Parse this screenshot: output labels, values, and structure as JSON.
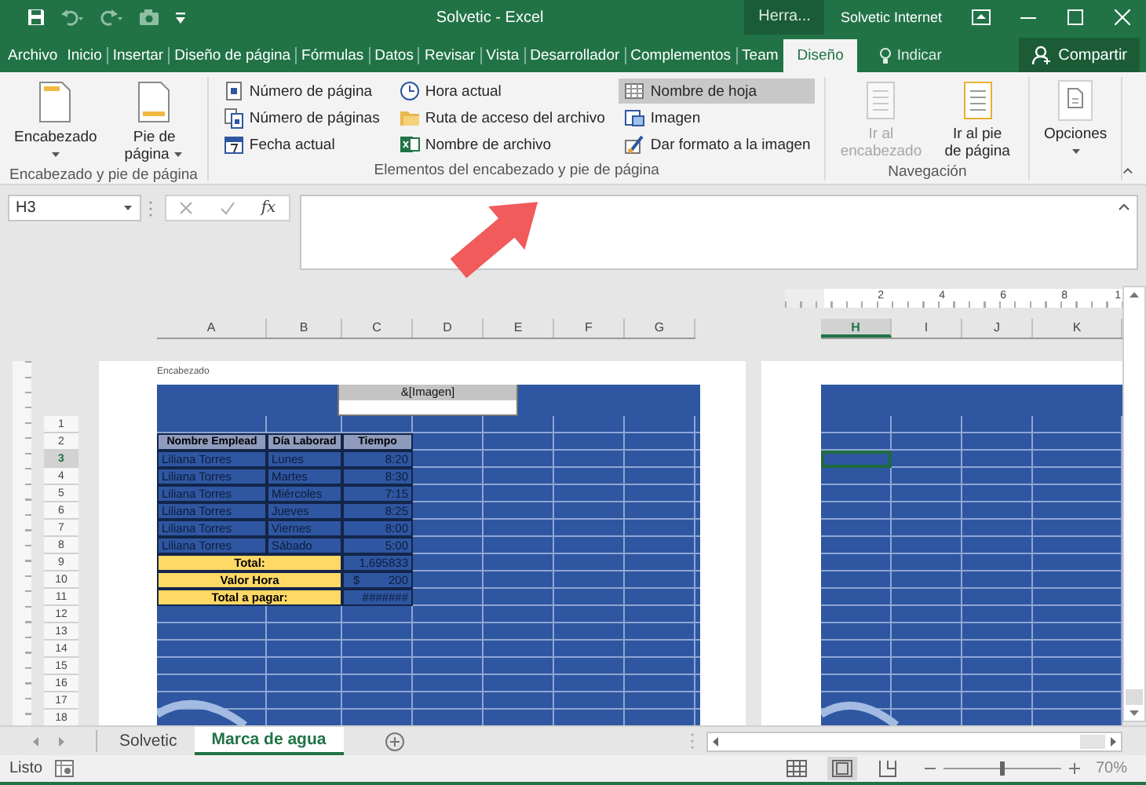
{
  "window": {
    "title": "Solvetic - Excel",
    "context_label": "Herra...",
    "account": "Solvetic Internet"
  },
  "ribbon_tabs": [
    {
      "label": "Archivo",
      "selected": false
    },
    {
      "label": "Inicio",
      "selected": false
    },
    {
      "label": "Insertar",
      "selected": false
    },
    {
      "label": "Diseño de página",
      "selected": false
    },
    {
      "label": "Fórmulas",
      "selected": false
    },
    {
      "label": "Datos",
      "selected": false
    },
    {
      "label": "Revisar",
      "selected": false
    },
    {
      "label": "Vista",
      "selected": false
    },
    {
      "label": "Desarrollador",
      "selected": false
    },
    {
      "label": "Complementos",
      "selected": false
    },
    {
      "label": "Team",
      "selected": false
    },
    {
      "label": "Diseño",
      "selected": true
    }
  ],
  "tell_me": "Indicar",
  "share_button": "Compartir",
  "ribbon_groups": [
    {
      "kind": "large",
      "label": "Encabezado y pie de página",
      "buttons": [
        {
          "label": "Encabezado",
          "dropdown": true,
          "disabled": false
        },
        {
          "label": "Pie de página",
          "dropdown": true,
          "disabled": false
        }
      ]
    },
    {
      "kind": "small",
      "label": "Elementos del encabezado y pie de página",
      "columns": [
        [
          {
            "label": "Número de página",
            "highlighted": false
          },
          {
            "label": "Número de páginas",
            "highlighted": false
          },
          {
            "label": "Fecha actual",
            "highlighted": false
          }
        ],
        [
          {
            "label": "Hora actual",
            "highlighted": false
          },
          {
            "label": "Ruta de acceso del archivo",
            "highlighted": false
          },
          {
            "label": "Nombre de archivo",
            "highlighted": false
          }
        ],
        [
          {
            "label": "Nombre de hoja",
            "highlighted": true
          },
          {
            "label": "Imagen",
            "highlighted": false
          },
          {
            "label": "Dar formato a la imagen",
            "highlighted": false
          }
        ]
      ]
    },
    {
      "kind": "large",
      "label": "Navegación",
      "buttons": [
        {
          "label": "Ir al encabezado",
          "dropdown": false,
          "disabled": true
        },
        {
          "label": "Ir al pie de página",
          "dropdown": false,
          "disabled": false
        }
      ]
    },
    {
      "kind": "options",
      "buttons": [
        {
          "label": "Opciones",
          "dropdown": true,
          "disabled": false
        }
      ]
    }
  ],
  "formula_bar": {
    "name_box": "H3",
    "function_label": "fx"
  },
  "sheet": {
    "columns_left": [
      {
        "label": "A",
        "selected": false
      },
      {
        "label": "B",
        "selected": false
      },
      {
        "label": "C",
        "selected": false
      },
      {
        "label": "D",
        "selected": false
      },
      {
        "label": "E",
        "selected": false
      },
      {
        "label": "F",
        "selected": false
      },
      {
        "label": "G",
        "selected": false
      }
    ],
    "columns_right": [
      {
        "label": "H",
        "selected": true
      },
      {
        "label": "I",
        "selected": false
      },
      {
        "label": "J",
        "selected": false
      },
      {
        "label": "K",
        "selected": false
      }
    ],
    "ruler_labels": [
      "2",
      "4",
      "6",
      "8",
      "1"
    ],
    "rows": [
      {
        "label": "1",
        "selected": false
      },
      {
        "label": "2",
        "selected": false
      },
      {
        "label": "3",
        "selected": true
      },
      {
        "label": "4",
        "selected": false
      },
      {
        "label": "5",
        "selected": false
      },
      {
        "label": "6",
        "selected": false
      },
      {
        "label": "7",
        "selected": false
      },
      {
        "label": "8",
        "selected": false
      },
      {
        "label": "9",
        "selected": false
      },
      {
        "label": "10",
        "selected": false
      },
      {
        "label": "11",
        "selected": false
      },
      {
        "label": "12",
        "selected": false
      },
      {
        "label": "13",
        "selected": false
      },
      {
        "label": "14",
        "selected": false
      },
      {
        "label": "15",
        "selected": false
      },
      {
        "label": "16",
        "selected": false
      },
      {
        "label": "17",
        "selected": false
      },
      {
        "label": "18",
        "selected": false
      }
    ],
    "header_label": "Encabezado",
    "header_field": "&[Imagen]",
    "table": [
      {
        "kind": "header",
        "cells": [
          "Nombre Emplead",
          "Día Laborad",
          "Tiempo"
        ]
      },
      {
        "kind": "data",
        "cells": [
          "Liliana Torres",
          "Lunes",
          "8:20"
        ]
      },
      {
        "kind": "data",
        "cells": [
          "Liliana Torres",
          "Martes",
          "8:30"
        ]
      },
      {
        "kind": "data",
        "cells": [
          "Liliana Torres",
          "Miércoles",
          "7:15"
        ]
      },
      {
        "kind": "data",
        "cells": [
          "Liliana Torres",
          "Jueves",
          "8:25"
        ]
      },
      {
        "kind": "data",
        "cells": [
          "Liliana Torres",
          "Viernes",
          "8:00"
        ]
      },
      {
        "kind": "data",
        "cells": [
          "Liliana Torres",
          "Sábado",
          "5:00"
        ]
      },
      {
        "kind": "summary",
        "label": "Total:",
        "value": "1,695833"
      },
      {
        "kind": "summary",
        "label": "Valor Hora",
        "currency": "$",
        "value": "200"
      },
      {
        "kind": "summary",
        "label": "Total a pagar:",
        "value": "#######"
      }
    ]
  },
  "sheet_tabs": [
    {
      "label": "Solvetic",
      "selected": false
    },
    {
      "label": "Marca de agua",
      "selected": true
    }
  ],
  "status_bar": {
    "text": "Listo",
    "views": [
      {
        "kind": "normal",
        "selected": false
      },
      {
        "kind": "page_layout",
        "selected": true
      },
      {
        "kind": "page_break",
        "selected": false
      }
    ],
    "level": 0.5,
    "zoom": "70%"
  }
}
